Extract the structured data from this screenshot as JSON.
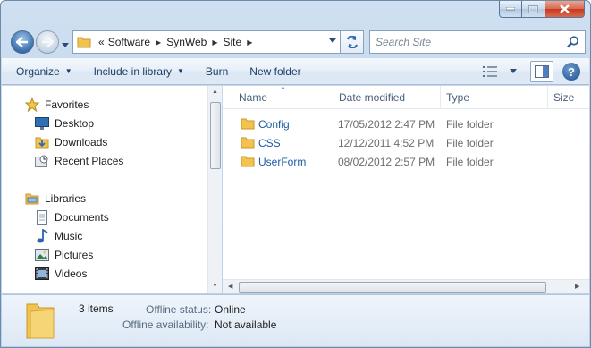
{
  "window": {
    "caption_buttons": [
      "minimize",
      "maximize",
      "close"
    ]
  },
  "nav": {
    "address": {
      "overflow": "«",
      "crumbs": [
        "Software",
        "SynWeb",
        "Site"
      ]
    },
    "search": {
      "placeholder": "Search Site"
    }
  },
  "commands": {
    "organize": "Organize",
    "include_in_library": "Include in library",
    "burn": "Burn",
    "new_folder": "New folder"
  },
  "tree": {
    "favorites": {
      "label": "Favorites",
      "items": [
        "Desktop",
        "Downloads",
        "Recent Places"
      ]
    },
    "libraries": {
      "label": "Libraries",
      "items": [
        "Documents",
        "Music",
        "Pictures",
        "Videos"
      ]
    }
  },
  "columns": [
    "Name",
    "Date modified",
    "Type",
    "Size"
  ],
  "files": [
    {
      "name": "Config",
      "date": "17/05/2012 2:47 PM",
      "type": "File folder"
    },
    {
      "name": "CSS",
      "date": "12/12/2011 4:52 PM",
      "type": "File folder"
    },
    {
      "name": "UserForm",
      "date": "08/02/2012 2:57 PM",
      "type": "File folder"
    }
  ],
  "details": {
    "count": "3 items",
    "offline_status_label": "Offline status:",
    "offline_status_value": "Online",
    "offline_availability_label": "Offline availability:",
    "offline_availability_value": "Not available"
  },
  "colors": {
    "link": "#1e5aa8",
    "folder": "#f2c44f",
    "frame": "#bcd3ea"
  }
}
